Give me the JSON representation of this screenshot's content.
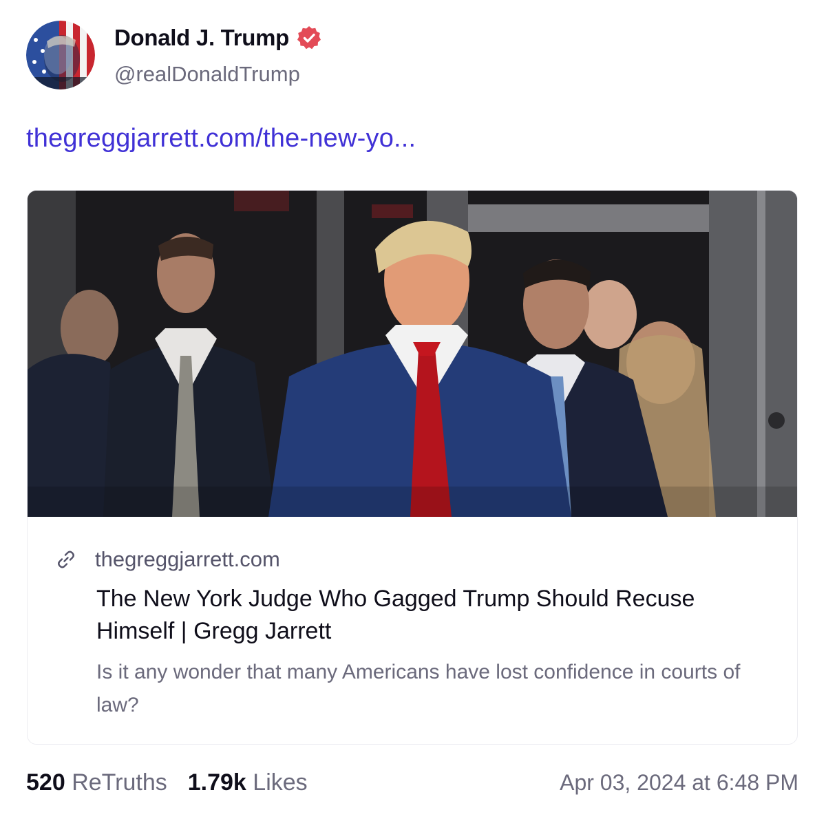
{
  "author": {
    "display_name": "Donald J. Trump",
    "handle": "@realDonaldTrump",
    "verified": true,
    "verified_color": "#e34b57"
  },
  "post": {
    "link_text": "thegreggjarrett.com/the-new-yo..."
  },
  "link_card": {
    "domain": "thegreggjarrett.com",
    "title": "The New York Judge Who Gagged Trump Should Recuse Himself | Gregg Jarrett",
    "description": "Is it any wonder that many Americans have lost confidence in courts of law?",
    "icon": "link-icon"
  },
  "stats": {
    "retruths_count": "520",
    "retruths_label": "ReTruths",
    "likes_count": "1.79k",
    "likes_label": "Likes"
  },
  "timestamp": "Apr 03, 2024 at 6:48 PM",
  "colors": {
    "link": "#4031d6",
    "secondary_text": "#6b6a7c",
    "primary_text": "#0f0e1a"
  }
}
